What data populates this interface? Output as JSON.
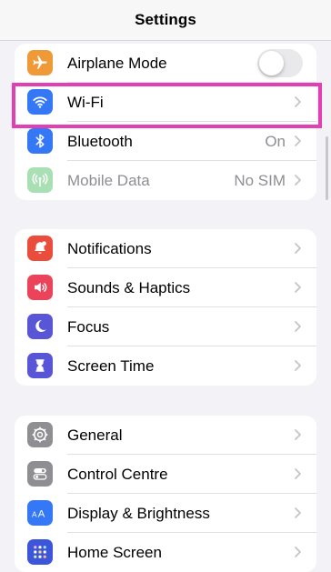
{
  "header": {
    "title": "Settings"
  },
  "groups": [
    {
      "rows": [
        {
          "label": "Airplane Mode",
          "icon": "airplane-icon",
          "color": "#f09a37",
          "control": "toggle",
          "toggle_on": false
        },
        {
          "label": "Wi-Fi",
          "icon": "wifi-icon",
          "color": "#3478f6",
          "value": ""
        },
        {
          "label": "Bluetooth",
          "icon": "bluetooth-icon",
          "color": "#3478f6",
          "value": "On"
        },
        {
          "label": "Mobile Data",
          "icon": "antenna-icon",
          "color": "#a8e0b4",
          "value": "No SIM",
          "disabled": true
        }
      ]
    },
    {
      "rows": [
        {
          "label": "Notifications",
          "icon": "notifications-icon",
          "color": "#eb4d3d"
        },
        {
          "label": "Sounds & Haptics",
          "icon": "speaker-icon",
          "color": "#eb445a"
        },
        {
          "label": "Focus",
          "icon": "moon-icon",
          "color": "#5856d6"
        },
        {
          "label": "Screen Time",
          "icon": "hourglass-icon",
          "color": "#5856d6"
        }
      ]
    },
    {
      "rows": [
        {
          "label": "General",
          "icon": "gear-icon",
          "color": "#8e8e93"
        },
        {
          "label": "Control Centre",
          "icon": "switches-icon",
          "color": "#8e8e93"
        },
        {
          "label": "Display & Brightness",
          "icon": "text-size-icon",
          "color": "#3478f6"
        },
        {
          "label": "Home Screen",
          "icon": "home-grid-icon",
          "color": "#3d56d9"
        }
      ]
    }
  ],
  "highlight_color": "#e33fb4"
}
